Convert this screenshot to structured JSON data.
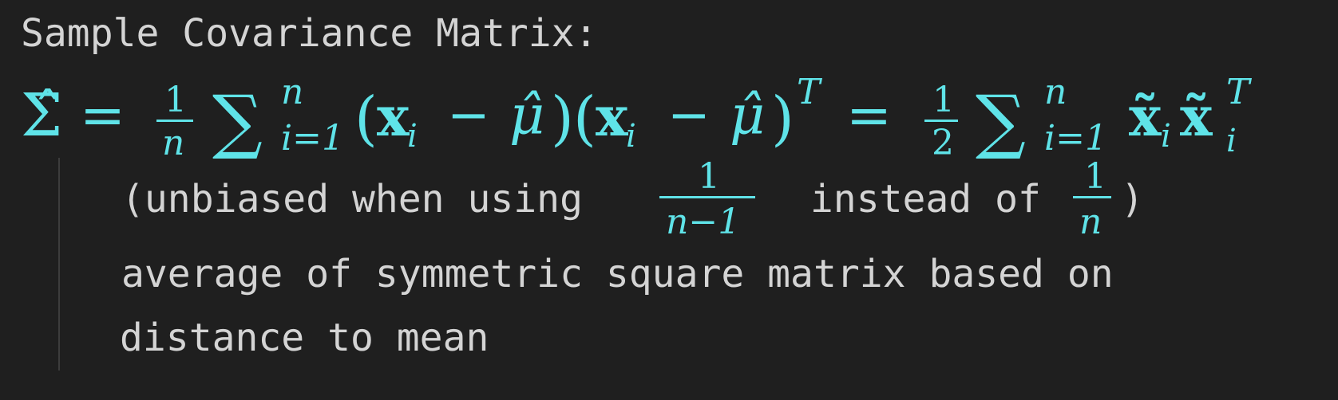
{
  "heading": "Sample Covariance Matrix:",
  "formula": {
    "lhs": "Σ̂",
    "equals": "=",
    "frac1": {
      "num": "1",
      "den": "n"
    },
    "sum1": {
      "symbol": "∑",
      "upper": "n",
      "lower": "i=1"
    },
    "term1": "(x",
    "sub_i": "i",
    "minus": "−",
    "mu_hat": "μ̂",
    "close_open": ")(x",
    "close": ")",
    "sup_T": "T",
    "frac2": {
      "num": "1",
      "den": "2"
    },
    "sum2": {
      "symbol": "∑",
      "upper": "n",
      "lower": "i=1"
    },
    "xtilde": "x̃"
  },
  "note": {
    "line1_prefix": "(unbiased when using ",
    "frac_a": {
      "num": "1",
      "den": "n−1"
    },
    "line1_mid": " instead of ",
    "frac_b": {
      "num": "1",
      "den": "n"
    },
    "line1_suffix": ")",
    "line2": "average of symmetric square matrix based on",
    "line3": "distance to mean"
  }
}
